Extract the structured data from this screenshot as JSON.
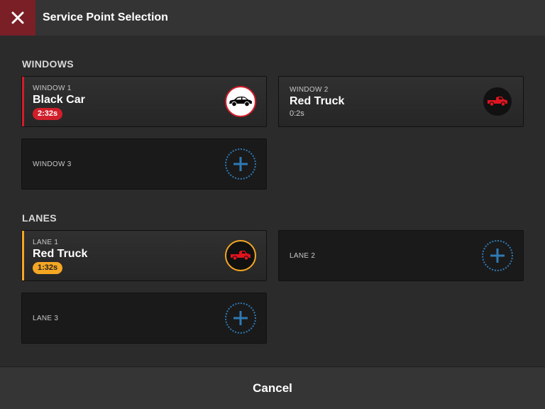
{
  "header": {
    "title": "Service Point Selection"
  },
  "colors": {
    "red": "#d01e2a",
    "amber": "#f5a623",
    "blue": "#2f7ab5",
    "close_bg": "#7a1f26"
  },
  "windows": {
    "title": "WINDOWS",
    "items": [
      {
        "label": "WINDOW 1",
        "vehicle": "Black Car",
        "timer": "2:32s",
        "icon": "car-icon"
      },
      {
        "label": "WINDOW 2",
        "vehicle": "Red Truck",
        "timer": "0:2s",
        "icon": "truck-icon"
      },
      {
        "label": "WINDOW 3",
        "icon": "add-icon"
      }
    ]
  },
  "lanes": {
    "title": "LANES",
    "items": [
      {
        "label": "LANE 1",
        "vehicle": "Red Truck",
        "timer": "1:32s",
        "icon": "truck-icon"
      },
      {
        "label": "LANE 2",
        "icon": "add-icon"
      },
      {
        "label": "LANE 3",
        "icon": "add-icon"
      }
    ]
  },
  "footer": {
    "cancel_label": "Cancel"
  }
}
